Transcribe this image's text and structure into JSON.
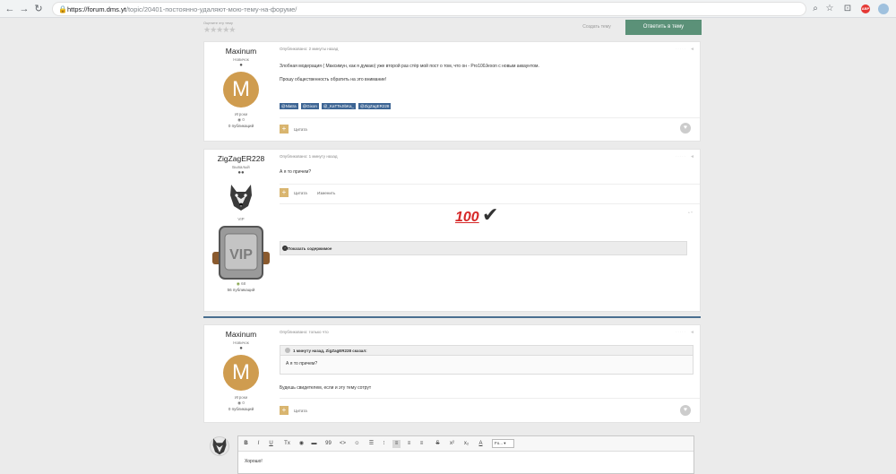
{
  "browser": {
    "url_host": "https://forum.dms.yt",
    "url_path": "/topic/20401-постоянно-удаляют-мою-тему-на-форуме/"
  },
  "topic_bar": {
    "rate_label": "Оцените эту тему",
    "rating": 0,
    "follow_label": "Создать тему",
    "reply_label": "Ответить в тему"
  },
  "posts": [
    {
      "author": "Maxinum",
      "rank": "Новичок",
      "avatar_letter": "M",
      "group": "Игроки",
      "reputation": "0",
      "posts_count": "0 публикаций",
      "meta": "Опубликовано: 2 минуты назад",
      "lines": [
        "Злобная модерация ( Максимун, как я думаю) уже второй раз стёр мой пост о том, что он - Pro100Jexon с новым аккаунтом.",
        "Прошу общественность обратить на это внимание!"
      ],
      "mentions": [
        "@Nlatra",
        "@Gixon",
        "@_KaTTeJIbKa_",
        "@ZigZagER228"
      ],
      "quote_label": "Цитата"
    },
    {
      "author": "ZigZagER228",
      "rank": "Бывалый",
      "group": "VIP",
      "vip_text": "VIP",
      "reputation": "68",
      "posts_count": "56 публикаций",
      "meta": "Опубликовано: 1 минуту назад",
      "lines": [
        "А я то причем?"
      ],
      "quote_label": "Цитата",
      "edit_label": "Изменить",
      "emoji_100": "100",
      "spoiler_label": "Показать содержимое"
    },
    {
      "author": "Maxinum",
      "rank": "Новичок",
      "avatar_letter": "M",
      "group": "Игроки",
      "reputation": "0",
      "posts_count": "0 публикаций",
      "meta": "Опубликовано: только что",
      "quote_header": "1 минуту назад, ZigZagER228 сказал:",
      "quote_body": "А я то причем?",
      "lines": [
        "Будешь свидетелем, если и эту тему сотрут"
      ],
      "quote_label": "Цитата"
    }
  ],
  "editor": {
    "toolbar": [
      "B",
      "I",
      "U",
      "Tx",
      "◉",
      "▬",
      "99",
      "<>",
      "☺",
      "☰",
      "⁝",
      "≡",
      "≡",
      "≡",
      "S",
      "x²",
      "x₂",
      "A"
    ],
    "format_label": "Fo...",
    "text": "Хорошо!"
  }
}
